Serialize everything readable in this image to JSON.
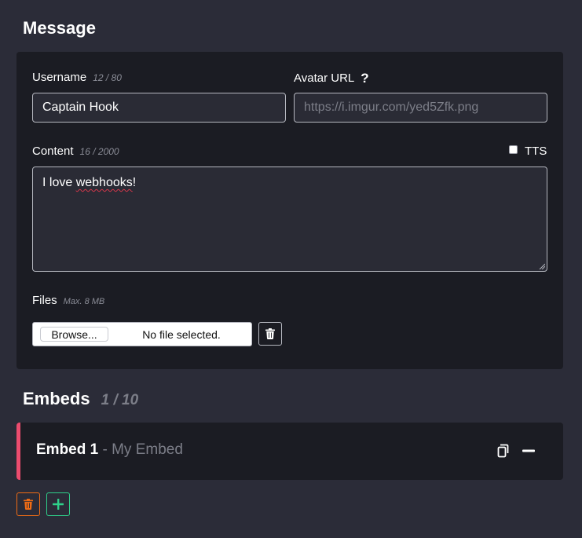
{
  "message": {
    "title": "Message",
    "username": {
      "label": "Username",
      "count": "12 / 80",
      "value": "Captain Hook"
    },
    "avatar": {
      "label": "Avatar URL",
      "help": "?",
      "placeholder": "https://i.imgur.com/yed5Zfk.png"
    },
    "content": {
      "label": "Content",
      "count": "16 / 2000",
      "value_prefix": "I love ",
      "value_misspelled": "webhooks",
      "value_suffix": "!"
    },
    "tts": {
      "label": "TTS",
      "checked": false
    },
    "files": {
      "label": "Files",
      "limit": "Max. 8 MB",
      "browse_label": "Browse...",
      "status": "No file selected."
    }
  },
  "embeds": {
    "title": "Embeds",
    "count": "1 / 10",
    "items": [
      {
        "name": "Embed 1",
        "subtitle": "- My Embed",
        "accent_color": "#ec4c6e"
      }
    ]
  },
  "colors": {
    "background": "#2b2c38",
    "card": "#1b1c23",
    "delete_accent": "#ef6c15",
    "add_accent": "#2fd08a"
  },
  "icons": {
    "help": "question-mark-icon",
    "clear_files": "trash-icon",
    "copy_embed": "copy-icon",
    "collapse_embed": "minus-icon",
    "delete_embeds": "trash-icon",
    "add_embed": "plus-icon"
  }
}
